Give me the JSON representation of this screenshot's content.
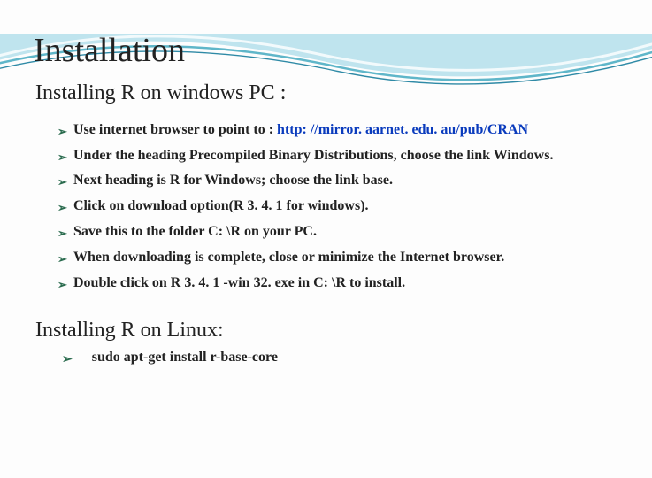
{
  "title": "Installation",
  "section_windows": {
    "heading": "Installing R on windows PC :",
    "items": [
      {
        "prefix": "Use internet browser to point to : ",
        "link": "http: //mirror. aarnet. edu. au/pub/CRAN",
        "suffix": ""
      },
      {
        "text": "Under the heading Precompiled Binary Distributions, choose the link Windows."
      },
      {
        "text": "Next heading is R for Windows; choose the link base."
      },
      {
        "text": "Click on download option(R 3. 4. 1 for windows)."
      },
      {
        "text": "Save this to the folder C: \\R on your PC."
      },
      {
        "text": "When downloading is complete, close or minimize the Internet browser."
      },
      {
        "text": "Double click on R 3. 4. 1 -win 32. exe in C: \\R to install."
      }
    ]
  },
  "section_linux": {
    "heading": "Installing R on Linux:",
    "command": "sudo apt-get install r-base-core"
  }
}
